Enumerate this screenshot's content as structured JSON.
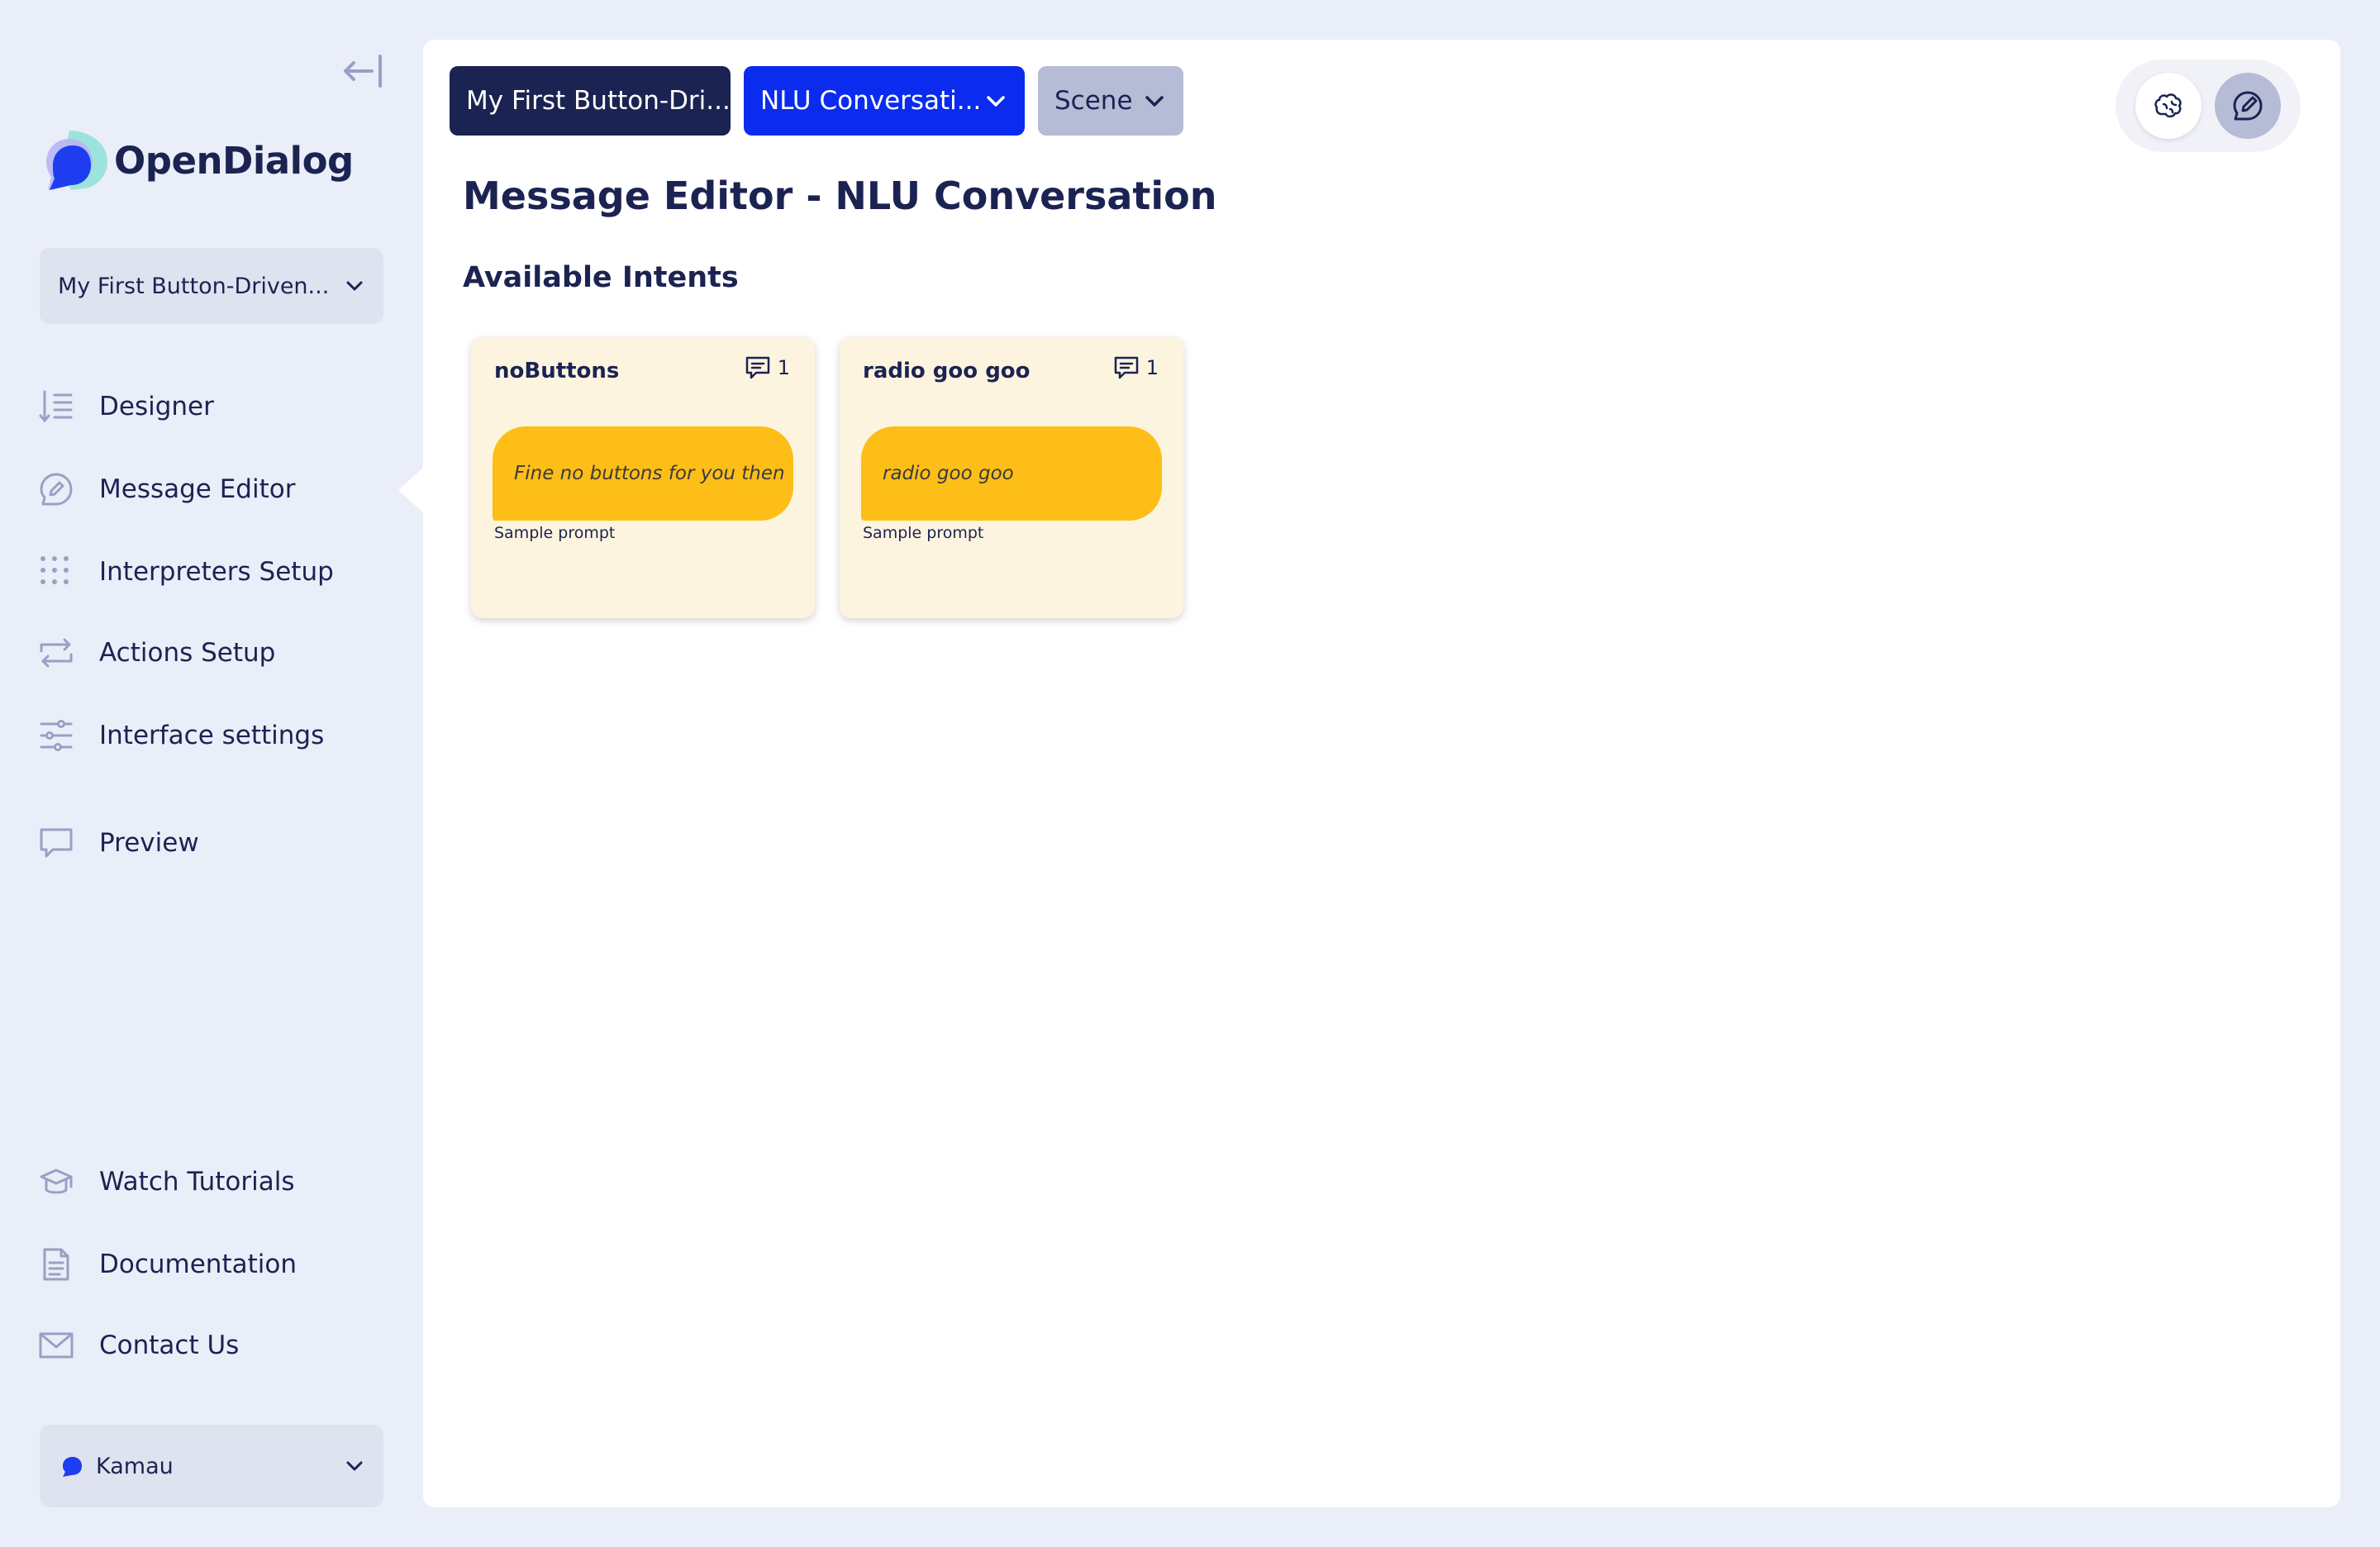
{
  "app": {
    "brand": "OpenDialog",
    "colors": {
      "navy": "#1b2352",
      "blue": "#0b2bef",
      "yellow": "#fdbe18",
      "card_bg": "#fdf4df",
      "sidebar_bg": "#eaeef8"
    }
  },
  "sidebar": {
    "scenario_select": "My First Button-Driven...",
    "nav": [
      {
        "label": "Designer",
        "icon": "designer-icon"
      },
      {
        "label": "Message Editor",
        "icon": "message-editor-icon",
        "active": true
      },
      {
        "label": "Interpreters Setup",
        "icon": "interpreters-icon"
      },
      {
        "label": "Actions Setup",
        "icon": "actions-icon"
      },
      {
        "label": "Interface settings",
        "icon": "sliders-icon"
      },
      {
        "label": "Preview",
        "icon": "preview-icon"
      }
    ],
    "footer_nav": [
      {
        "label": "Watch Tutorials",
        "icon": "graduation-cap-icon"
      },
      {
        "label": "Documentation",
        "icon": "document-icon"
      },
      {
        "label": "Contact Us",
        "icon": "mail-icon"
      }
    ],
    "user": "Kamau"
  },
  "breadcrumbs": [
    {
      "label": "My First Button-Dri..."
    },
    {
      "label": "NLU Conversati..."
    },
    {
      "label": "Scene"
    }
  ],
  "page_title": "Message Editor - NLU Conversation",
  "section_title": "Available Intents",
  "intents": [
    {
      "name": "noButtons",
      "message_count": "1",
      "message": "Fine no buttons for you then",
      "caption": "Sample prompt"
    },
    {
      "name": "radio goo goo",
      "message_count": "1",
      "message": "radio goo goo",
      "caption": "Sample prompt"
    }
  ]
}
